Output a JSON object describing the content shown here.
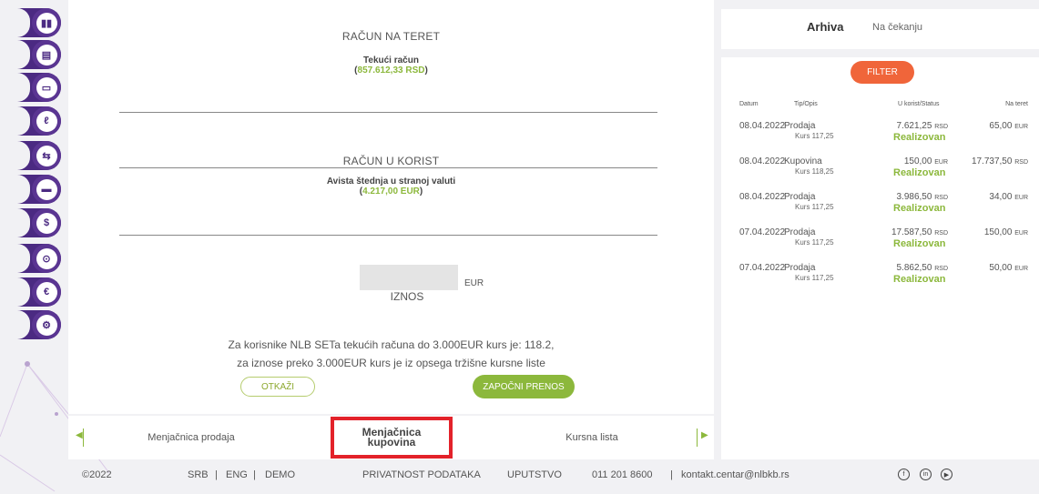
{
  "sidebar": {
    "icons": [
      "bar-chart-icon",
      "documents-icon",
      "card-icon",
      "leaf-icon",
      "exchange-icon",
      "wallet-icon",
      "dollar-cycle-icon",
      "location-pin-icon",
      "euro-cycle-icon",
      "gear-icon"
    ]
  },
  "form": {
    "debit_label": "RAČUN NA TERET",
    "debit_account_name": "Tekući račun",
    "debit_account_balance_open": "(",
    "debit_account_balance": "857.612,33 RSD",
    "debit_account_balance_close": ")",
    "credit_label": "RAČUN U KORIST",
    "credit_account_name": "Avista štednja u stranoj valuti",
    "credit_account_balance_open": "(",
    "credit_account_balance": "4.217,00 EUR",
    "credit_account_balance_close": ")",
    "amount_value": "",
    "amount_currency": "EUR",
    "amount_label": "IZNOS",
    "info_line1": "Za korisnike NLB SETa tekućih računa do 3.000EUR kurs je: 118.2,",
    "info_line2": "za iznose preko 3.000EUR kurs je iz opsega tržišne kursne liste",
    "cancel_label": "OTKAŽI",
    "start_label": "ZAPOČNI PRENOS"
  },
  "tabs": {
    "left": "Menjačnica prodaja",
    "active_line1": "Menjačnica",
    "active_line2": "kupovina",
    "right": "Kursna lista"
  },
  "right": {
    "tab_archive": "Arhiva",
    "tab_pending": "Na čekanju",
    "filter_label": "FILTER",
    "col_date": "Datum",
    "col_type": "Tip/Opis",
    "col_credit": "U korist/Status",
    "col_debit": "Na teret",
    "rows": [
      {
        "date": "08.04.2022",
        "type": "Prodaja",
        "rate": "Kurs 117,25",
        "credit": "7.621,25",
        "credit_cur": "RSD",
        "status": "Realizovan",
        "debit": "65,00",
        "debit_cur": "EUR"
      },
      {
        "date": "08.04.2022",
        "type": "Kupovina",
        "rate": "Kurs 118,25",
        "credit": "150,00",
        "credit_cur": "EUR",
        "status": "Realizovan",
        "debit": "17.737,50",
        "debit_cur": "RSD"
      },
      {
        "date": "08.04.2022",
        "type": "Prodaja",
        "rate": "Kurs 117,25",
        "credit": "3.986,50",
        "credit_cur": "RSD",
        "status": "Realizovan",
        "debit": "34,00",
        "debit_cur": "EUR"
      },
      {
        "date": "07.04.2022",
        "type": "Prodaja",
        "rate": "Kurs 117,25",
        "credit": "17.587,50",
        "credit_cur": "RSD",
        "status": "Realizovan",
        "debit": "150,00",
        "debit_cur": "EUR"
      },
      {
        "date": "07.04.2022",
        "type": "Prodaja",
        "rate": "Kurs 117,25",
        "credit": "5.862,50",
        "credit_cur": "RSD",
        "status": "Realizovan",
        "debit": "50,00",
        "debit_cur": "EUR"
      }
    ]
  },
  "footer": {
    "copyright": "©2022",
    "lang_srb": "SRB",
    "sep1": "|",
    "lang_eng": "ENG",
    "sep2": "|",
    "demo": "DEMO",
    "privacy": "PRIVATNOST PODATAKA",
    "guide": "UPUTSTVO",
    "phone": "011 201 8600",
    "sep3": "|",
    "email": "kontakt.centar@nlbkb.rs",
    "social_icons": [
      "facebook-icon",
      "linkedin-icon",
      "youtube-icon"
    ]
  },
  "colors": {
    "brand_purple": "#4b2a82",
    "accent_green": "#8cb83c",
    "filter_orange": "#f0653a",
    "highlight_red": "#e3222a"
  }
}
